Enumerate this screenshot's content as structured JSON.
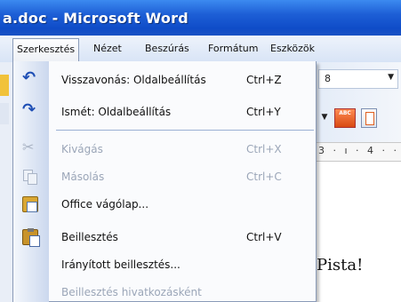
{
  "window": {
    "title": "a.doc - Microsoft Word"
  },
  "menubar": {
    "items": [
      {
        "label": "Szerkesztés",
        "active": true
      },
      {
        "label": "Nézet"
      },
      {
        "label": "Beszúrás"
      },
      {
        "label": "Formátum"
      },
      {
        "label": "Eszközök"
      }
    ]
  },
  "toolbar": {
    "combo_value": "8",
    "combo_arrow": "▼",
    "dropdown_arrow": "▼",
    "spell_button_text": "ABC"
  },
  "ruler": {
    "text": "3 · ı · 4 · ·"
  },
  "document": {
    "text": "Pista!"
  },
  "edit_menu": {
    "items": [
      {
        "label": "Visszavonás: Oldalbeállítás",
        "shortcut": "Ctrl+Z",
        "icon": "undo-icon",
        "enabled": true
      },
      {
        "label": "Ismét: Oldalbeállítás",
        "shortcut": "Ctrl+Y",
        "icon": "redo-icon",
        "enabled": true
      },
      {
        "label": "Kivágás",
        "shortcut": "Ctrl+X",
        "icon": "scissors-icon",
        "enabled": false
      },
      {
        "label": "Másolás",
        "shortcut": "Ctrl+C",
        "icon": "copy-icon",
        "enabled": false
      },
      {
        "label": "Office vágólap...",
        "shortcut": "",
        "icon": "clipboard-icon",
        "enabled": true
      },
      {
        "label": "Beillesztés",
        "shortcut": "Ctrl+V",
        "icon": "paste-icon",
        "enabled": true
      },
      {
        "label": "Irányított beillesztés...",
        "shortcut": "",
        "icon": "",
        "enabled": true
      },
      {
        "label": "Beillesztés hivatkozásként",
        "shortcut": "",
        "icon": "",
        "enabled": false
      }
    ]
  }
}
